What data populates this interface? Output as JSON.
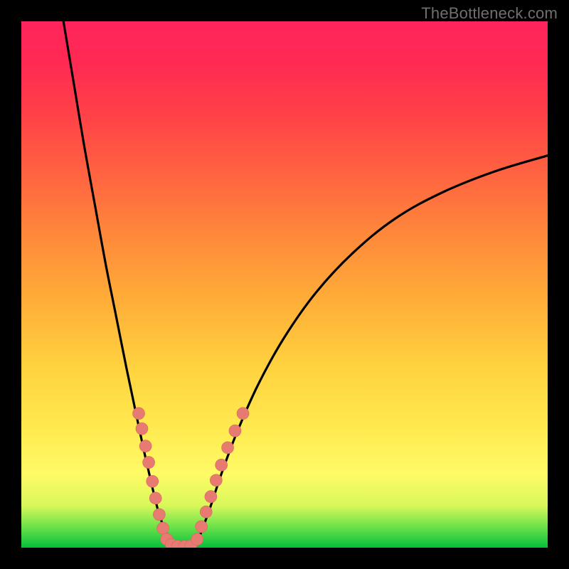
{
  "watermark": "TheBottleneck.com",
  "chart_data": {
    "type": "line",
    "title": "",
    "xlabel": "",
    "ylabel": "",
    "xlim": [
      0,
      100
    ],
    "ylim": [
      0,
      100
    ],
    "grid": false,
    "legend": false,
    "series": [
      {
        "name": "left-branch",
        "x": [
          8,
          10,
          12,
          14,
          16,
          18,
          20,
          22,
          23.5,
          25,
          26,
          27,
          28,
          28.8
        ],
        "values": [
          100,
          88,
          76,
          65,
          54,
          44,
          34,
          24.5,
          17.5,
          11,
          7,
          4,
          1.8,
          0.4
        ]
      },
      {
        "name": "right-branch",
        "x": [
          33,
          34,
          36,
          38,
          41,
          45,
          50,
          56,
          63,
          71,
          80,
          90,
          100
        ],
        "values": [
          0.4,
          2.5,
          8,
          14,
          22,
          31,
          40,
          48.5,
          56,
          62.5,
          67.5,
          71.5,
          74.5
        ]
      }
    ],
    "beads": {
      "left": [
        {
          "x": 22.3,
          "y": 25.5
        },
        {
          "x": 22.9,
          "y": 22.6
        },
        {
          "x": 23.6,
          "y": 19.3
        },
        {
          "x": 24.2,
          "y": 16.2
        },
        {
          "x": 24.9,
          "y": 12.6
        },
        {
          "x": 25.5,
          "y": 9.4
        },
        {
          "x": 26.2,
          "y": 6.3
        },
        {
          "x": 26.9,
          "y": 3.7
        },
        {
          "x": 27.6,
          "y": 1.6
        },
        {
          "x": 28.5,
          "y": 0.6
        },
        {
          "x": 29.7,
          "y": 0.25
        },
        {
          "x": 31.0,
          "y": 0.22
        },
        {
          "x": 32.2,
          "y": 0.35
        }
      ],
      "right": [
        {
          "x": 33.4,
          "y": 1.6
        },
        {
          "x": 34.2,
          "y": 4.0
        },
        {
          "x": 35.1,
          "y": 6.8
        },
        {
          "x": 36.0,
          "y": 9.7
        },
        {
          "x": 37.0,
          "y": 12.8
        },
        {
          "x": 38.0,
          "y": 15.7
        },
        {
          "x": 39.2,
          "y": 19.0
        },
        {
          "x": 40.6,
          "y": 22.2
        },
        {
          "x": 42.1,
          "y": 25.5
        }
      ]
    },
    "bead_radius": 1.15
  }
}
